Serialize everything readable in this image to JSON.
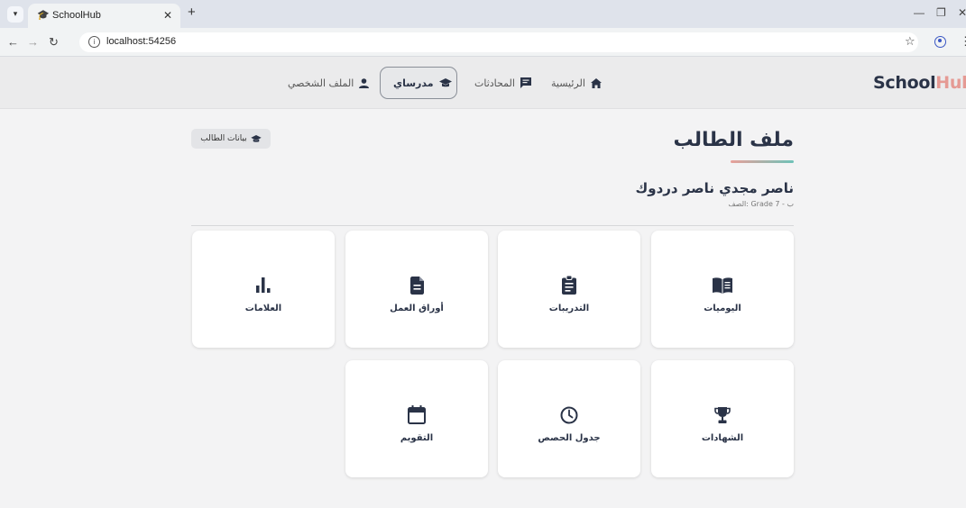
{
  "browser": {
    "tab_title": "SchoolHub",
    "new_tab_label": "+",
    "url": "localhost:54256"
  },
  "app": {
    "brand_part1": "School",
    "brand_part2": "Hub",
    "nav": [
      {
        "label": "الرئيسية",
        "icon": "home-icon"
      },
      {
        "label": "المحادثات",
        "icon": "chat-icon"
      },
      {
        "label": "مدرساي",
        "icon": "graduation-cap-icon",
        "active": true
      },
      {
        "label": "الملف الشخصي",
        "icon": "user-icon"
      }
    ]
  },
  "page": {
    "title": "ملف الطالب",
    "student_data_button": "بيانات الطالب",
    "student_name": "ناصر مجدي ناصر دردوك",
    "student_grade": "الصف: Grade 7 - ب"
  },
  "cards": [
    {
      "label": "اليوميات",
      "icon": "book-icon"
    },
    {
      "label": "التدريبات",
      "icon": "clipboard-icon"
    },
    {
      "label": "أوراق العمل",
      "icon": "document-icon"
    },
    {
      "label": "العلامات",
      "icon": "bar-chart-icon"
    },
    {
      "label": "الشهادات",
      "icon": "trophy-icon"
    },
    {
      "label": "جدول الحصص",
      "icon": "clock-icon"
    },
    {
      "label": "التقويم",
      "icon": "calendar-icon"
    }
  ],
  "colors": {
    "brand_dark": "#2a3347",
    "brand_accent": "#e59a94",
    "underline_start": "#e8a09a",
    "underline_end": "#6ec2b8"
  }
}
